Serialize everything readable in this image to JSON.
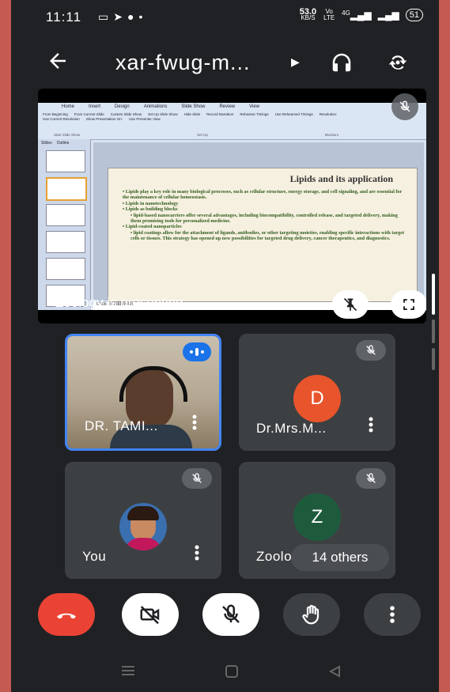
{
  "status": {
    "time": "11:11",
    "left_icons": [
      "screen-record-icon",
      "telegram-icon",
      "messenger-icon",
      "dot-icon"
    ],
    "speed_value": "53.0",
    "speed_unit": "KB/S",
    "volte": "Vo LTE",
    "signal": "4G",
    "battery": "51"
  },
  "header": {
    "title": "xar-fwug-m...",
    "icons": [
      "back-arrow-icon",
      "caret-right-icon",
      "headphones-icon",
      "camera-switch-icon"
    ]
  },
  "presentation": {
    "presenter_label": "Zoology is presenting",
    "slide": {
      "title": "Lipids and its application",
      "bullets": [
        {
          "level": 1,
          "text": "Lipids play a key role in many biological processes, such as cellular structure, energy storage, and cell signaling, and are essential for the maintenance of cellular homeostasis."
        },
        {
          "level": 1,
          "text": "Lipids in nanotechnology"
        },
        {
          "level": 1,
          "text": "Lipids as building blocks"
        },
        {
          "level": 2,
          "text": "lipid-based nanocarriers offer several advantages, including biocompatibility, controlled release, and targeted delivery, making them promising tools for personalized medicine."
        },
        {
          "level": 1,
          "text": "Lipid-coated nanoparticles"
        },
        {
          "level": 2,
          "text": "lipid coatings allow for the attachment of ligands, antibodies, or other targeting moieties, enabling specific interactions with target cells or tissues. This strategy has opened up new possibilities for targeted drug delivery, cancer therapeutics, and diagnostics."
        }
      ]
    },
    "notes_placeholder": "Click to add notes",
    "ribbon_tabs": [
      "Home",
      "Insert",
      "Design",
      "Animations",
      "Slide Show",
      "Review",
      "View"
    ],
    "ribbon_items": [
      "From Beginning",
      "From Current Slide",
      "Custom Slide Show",
      "Set Up Slide Show",
      "Hide Slide",
      "Record Narration",
      "Rehearse Timings",
      "Use Rehearsed Timings",
      "Resolution:",
      "Use Current Resolution",
      "Show Presentation On:",
      "Use Presenter View"
    ],
    "ribbon_groups": [
      "Start Slide Show",
      "Set Up",
      "Monitors"
    ],
    "pane_tabs": [
      "Slides",
      "Outline"
    ]
  },
  "participants": [
    {
      "name": "DR. TAMI...",
      "avatar_letter": "",
      "avatar_color": "",
      "speaking": true
    },
    {
      "name": "Dr.Mrs.M...",
      "avatar_letter": "D",
      "avatar_color": "#e8542b",
      "speaking": false
    },
    {
      "name": "You",
      "avatar_letter": "",
      "avatar_color": "#3a6fb0",
      "speaking": false
    },
    {
      "name": "Zoolog",
      "avatar_letter": "Z",
      "avatar_color": "#1e5b3d",
      "speaking": false
    }
  ],
  "others_label": "14 others",
  "controls": [
    {
      "name": "end-call",
      "color": "#ea4335"
    },
    {
      "name": "camera-off",
      "color": "#ffffff"
    },
    {
      "name": "mic-off",
      "color": "#ffffff"
    },
    {
      "name": "raise-hand",
      "color": "#3c4043"
    },
    {
      "name": "more-options",
      "color": "#3c4043"
    }
  ],
  "nav": [
    "recents-icon",
    "home-icon",
    "back-icon"
  ]
}
